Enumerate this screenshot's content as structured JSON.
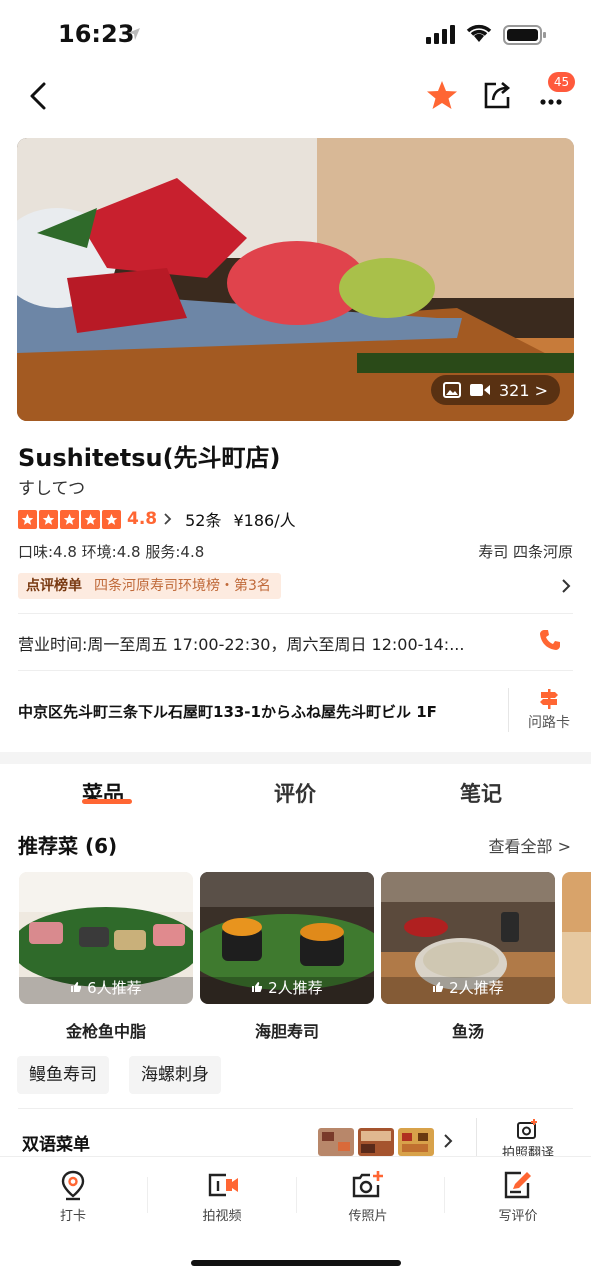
{
  "status_bar": {
    "time": "16:23"
  },
  "nav": {
    "badge": "45"
  },
  "hero": {
    "media_count": "321 >"
  },
  "restaurant": {
    "name": "Sushitetsu(先斗町店)",
    "kana": "すしてつ",
    "score": "4.8",
    "review_count": "52条",
    "price": "¥186/人",
    "sub_scores": "口味:4.8 环境:4.8 服务:4.8",
    "category": "寿司 四条河原",
    "rank_label": "点评榜单",
    "rank_text": "四条河原寿司环境榜・第3名",
    "hours": "营业时间:周一至周五 17:00-22:30，周六至周日 12:00-14:...",
    "address": "中京区先斗町三条下ル石屋町133-1からふね屋先斗町ビル 1F",
    "route_card": "问路卡"
  },
  "tabs": [
    {
      "label": "菜品"
    },
    {
      "label": "评价"
    },
    {
      "label": "笔记"
    }
  ],
  "recommended": {
    "title": "推荐菜 (6)",
    "view_all": "查看全部 >",
    "dishes": [
      {
        "name": "金枪鱼中脂",
        "recommend": "6人推荐"
      },
      {
        "name": "海胆寿司",
        "recommend": "2人推荐"
      },
      {
        "name": "鱼汤",
        "recommend": "2人推荐"
      }
    ],
    "chips": [
      "鳗鱼寿司",
      "海螺刺身"
    ]
  },
  "bilingual_menu": {
    "title": "双语菜单",
    "scan_label": "拍照翻译"
  },
  "bottom_bar": [
    {
      "label": "打卡"
    },
    {
      "label": "拍视频"
    },
    {
      "label": "传照片"
    },
    {
      "label": "写评价"
    }
  ],
  "colors": {
    "accent": "#ff6633",
    "badge": "#ff5a3c",
    "rank_bg": "#fdebe0"
  }
}
